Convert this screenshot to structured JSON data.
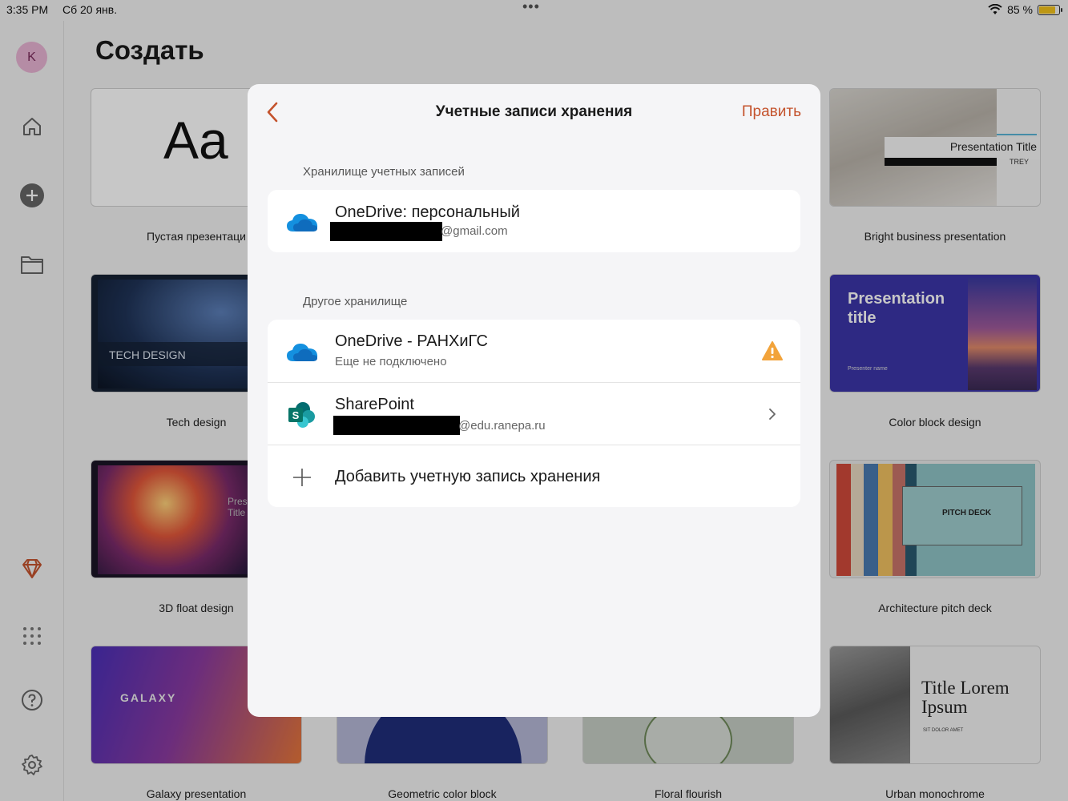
{
  "status_bar": {
    "time": "3:35 PM",
    "date": "Сб 20 янв.",
    "battery": "85 %",
    "battery_level": 0.85
  },
  "sidebar": {
    "avatar_initial": "K"
  },
  "page": {
    "title": "Создать"
  },
  "templates": [
    {
      "label": "Пустая презентаци",
      "thumb_text": "Aa"
    },
    {
      "label": "Bright business presentation",
      "thumb_text": "Presentation Title",
      "thumb_sub": "TREY"
    },
    {
      "label": "Tech design",
      "thumb_text": "TECH DESIGN"
    },
    {
      "label": "Color block design",
      "thumb_text": "Presentation title",
      "thumb_sub": "Presenter name"
    },
    {
      "label": "3D float design",
      "thumb_text": "Pres Title"
    },
    {
      "label": "Architecture pitch deck",
      "thumb_text": "PITCH DECK"
    },
    {
      "label": "Galaxy presentation",
      "thumb_text": "GALAXY"
    },
    {
      "label": "Geometric color block"
    },
    {
      "label": "Floral flourish"
    },
    {
      "label": "Urban monochrome",
      "thumb_text": "Title Lorem Ipsum",
      "thumb_sub": "SIT DOLOR AMET"
    }
  ],
  "modal": {
    "title": "Учетные записи хранения",
    "edit_label": "Править",
    "section_accounts": "Хранилище учетных записей",
    "section_other": "Другое хранилище",
    "accounts": [
      {
        "title": "OneDrive: персональный",
        "sub": "@gmail.com"
      }
    ],
    "other": [
      {
        "title": "OneDrive - РАНХиГС",
        "sub": "Еще не подключено"
      },
      {
        "title": "SharePoint",
        "sub": "@edu.ranepa.ru"
      }
    ],
    "add_label": "Добавить учетную запись хранения"
  },
  "colors": {
    "accent": "#c4532d",
    "warning": "#f2a33a",
    "onedrive": "#0f6cbd",
    "sharepoint": "#077568"
  }
}
